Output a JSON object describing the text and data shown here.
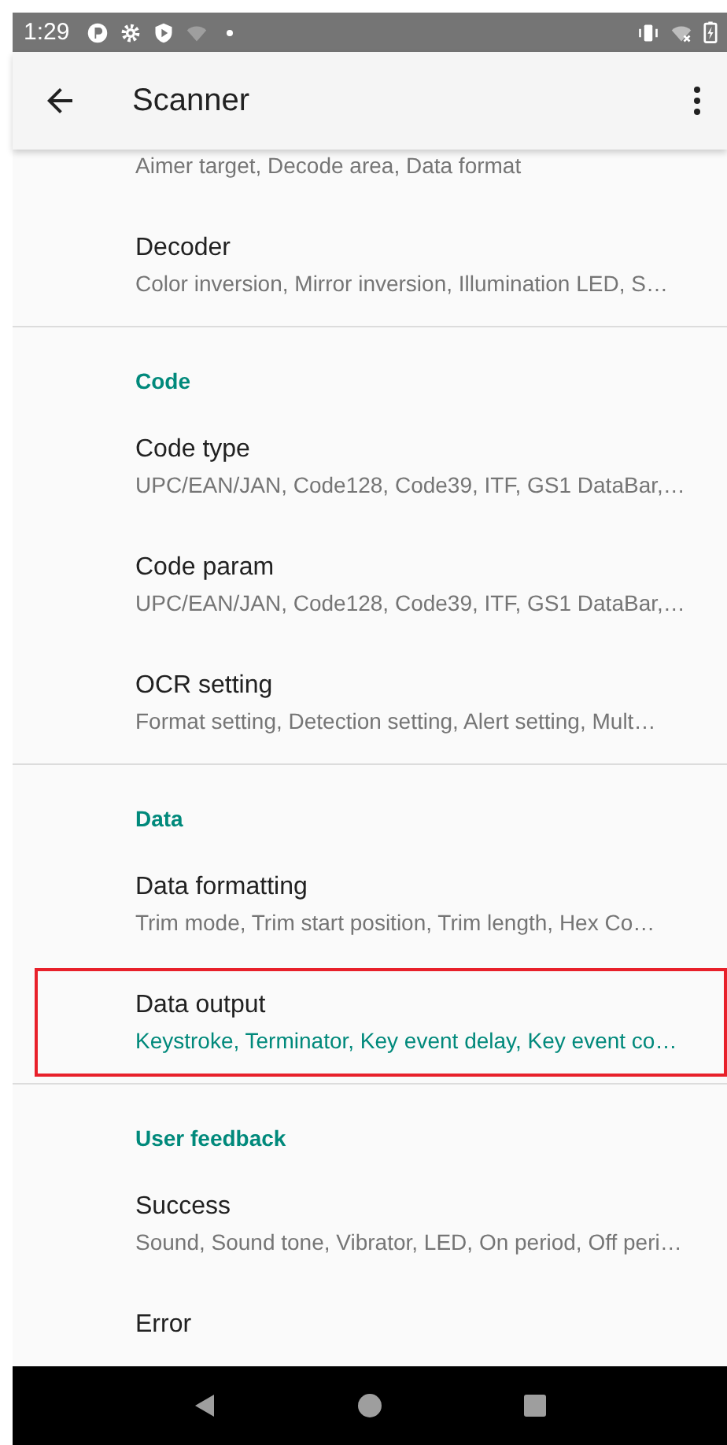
{
  "status_bar": {
    "time": "1:29"
  },
  "toolbar": {
    "title": "Scanner"
  },
  "list": [
    {
      "kind": "item",
      "summary": "Aimer target, Decode area, Data format",
      "highlighted": false
    },
    {
      "kind": "item",
      "title": "Decoder",
      "summary": "Color inversion, Mirror inversion, Illumination LED, S…",
      "highlighted": false
    },
    {
      "kind": "header",
      "title": "Code"
    },
    {
      "kind": "item",
      "title": "Code type",
      "summary": "UPC/EAN/JAN, Code128, Code39, ITF, GS1 DataBar,…",
      "highlighted": false
    },
    {
      "kind": "item",
      "title": "Code param",
      "summary": "UPC/EAN/JAN, Code128, Code39, ITF, GS1 DataBar,…",
      "highlighted": false
    },
    {
      "kind": "item",
      "title": "OCR setting",
      "summary": "Format setting, Detection setting, Alert setting, Mult…",
      "highlighted": false
    },
    {
      "kind": "header",
      "title": "Data"
    },
    {
      "kind": "item",
      "title": "Data formatting",
      "summary": "Trim mode, Trim start position, Trim length, Hex Co…",
      "highlighted": false
    },
    {
      "kind": "item",
      "title": "Data output",
      "summary": "Keystroke, Terminator, Key event delay, Key event co…",
      "highlighted": true
    },
    {
      "kind": "header",
      "title": "User feedback"
    },
    {
      "kind": "item",
      "title": "Success",
      "summary": "Sound, Sound tone, Vibrator, LED, On period, Off peri…",
      "highlighted": false
    },
    {
      "kind": "item",
      "title": "Error"
    }
  ]
}
